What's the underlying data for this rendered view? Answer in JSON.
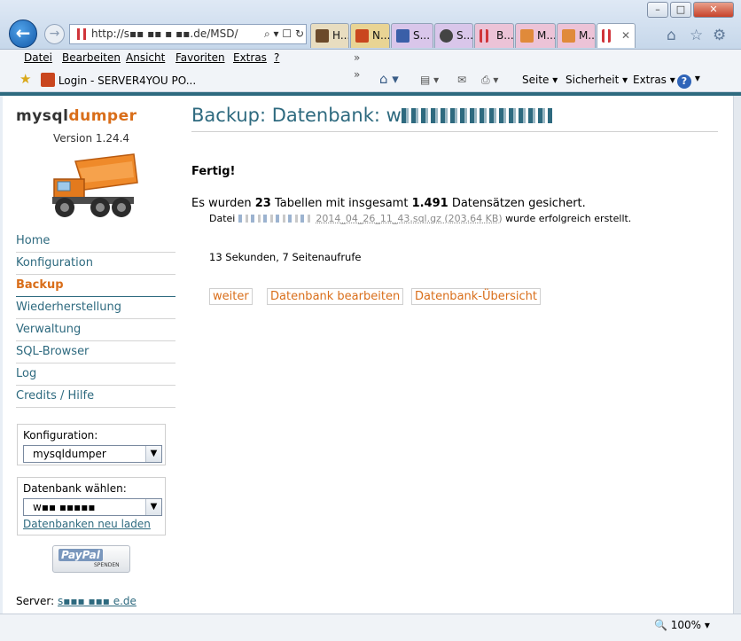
{
  "browser": {
    "address": "http://s▪▪ ▪▪ ▪ ▪▪.de/MSD/",
    "address_controls": "⌕ ▾ ☐ ↻",
    "tabs": [
      {
        "label": "H..."
      },
      {
        "label": "N..."
      },
      {
        "label": "S..."
      },
      {
        "label": "S..."
      },
      {
        "label": "B..."
      },
      {
        "label": "M..."
      },
      {
        "label": "M..."
      },
      {
        "label": ""
      }
    ],
    "window_controls": {
      "minimize": "–",
      "maximize": "□",
      "close": "✕"
    },
    "menu": [
      "Datei",
      "Bearbeiten",
      "Ansicht",
      "Favoriten",
      "Extras",
      "?"
    ],
    "favorite": "Login - SERVER4YOU PO...",
    "command_bar": {
      "page": "Seite ▾",
      "safety": "Sicherheit ▾",
      "tools": "Extras ▾"
    },
    "zoom": "100%"
  },
  "sidebar": {
    "logo_a": "mysql",
    "logo_b": "dumper",
    "version": "Version 1.24.4",
    "nav": [
      "Home",
      "Konfiguration",
      "Backup",
      "Wiederherstellung",
      "Verwaltung",
      "SQL-Browser",
      "Log",
      "Credits / Hilfe"
    ],
    "active_nav": "Backup",
    "config_label": "Konfiguration:",
    "config_value": "mysqldumper",
    "db_label": "Datenbank wählen:",
    "db_value": "w▪▪ ▪▪▪▪▪",
    "reload_link": "Datenbanken neu laden",
    "paypal": "PayPal",
    "paypal_sub": "SPENDEN",
    "server_label": "Server:",
    "server_value": "s▪▪▪ ▪▪▪ e.de"
  },
  "main": {
    "title": "Backup: Datenbank: w",
    "done": "Fertig!",
    "summary_pre": "Es wurden ",
    "tables": "23",
    "summary_mid": " Tabellen mit insgesamt ",
    "records": "1.491",
    "summary_post": " Datensätzen gesichert.",
    "file_pre": "Datei ",
    "file_name": "2014_04_26_11_43.sql.gz (203.64 KB)",
    "file_post": " wurde erfolgreich erstellt.",
    "stats": "13 Sekunden, 7 Seitenaufrufe",
    "buttons": [
      "weiter",
      "Datenbank bearbeiten",
      "Datenbank-Übersicht"
    ]
  }
}
